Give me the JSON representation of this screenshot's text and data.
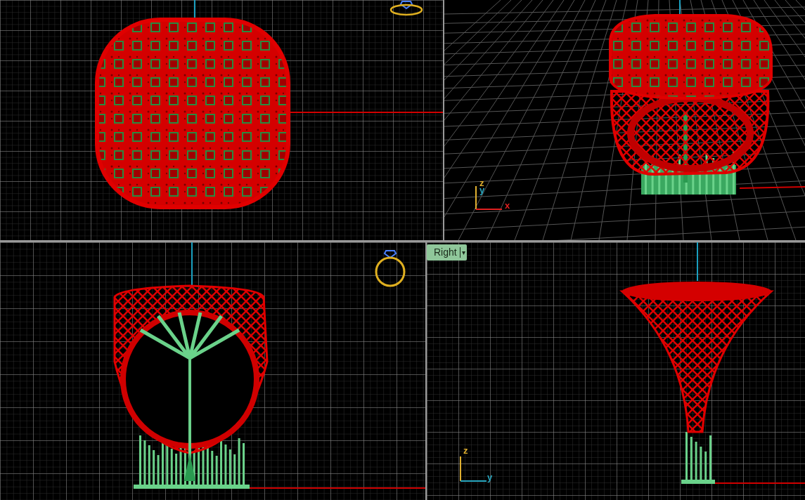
{
  "viewports": [
    {
      "kind": "top"
    },
    {
      "kind": "perspective",
      "axis_labels": [
        {
          "text": "z",
          "color": "#e0b030"
        },
        {
          "text": "y",
          "color": "#2aa8c0"
        },
        {
          "text": "x",
          "color": "#e02020"
        }
      ]
    },
    {
      "kind": "front"
    },
    {
      "kind": "right",
      "tab": {
        "label": "Right",
        "caret": "▾"
      },
      "axis_labels": [
        {
          "text": "z",
          "color": "#e0b030"
        },
        {
          "text": "y",
          "color": "#2aa8c0"
        }
      ]
    }
  ]
}
